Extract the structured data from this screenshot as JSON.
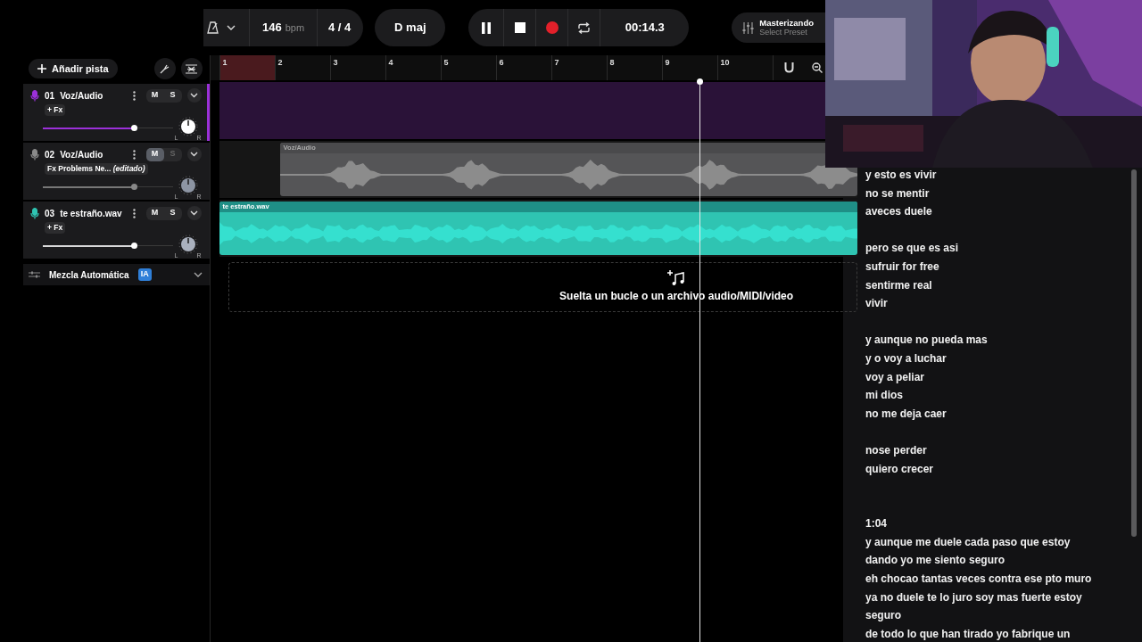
{
  "toolbar": {
    "bpm": "146",
    "bpm_unit": "bpm",
    "time_signature": "4 / 4",
    "key": "D maj",
    "playing": true,
    "time": "00:14.3",
    "mastering": {
      "title": "Masterizando",
      "preset": "Select Preset"
    }
  },
  "track_panel": {
    "add_button": "Añadir pista",
    "auto_mix": {
      "label": "Mezcla Automática",
      "badge": "IA"
    }
  },
  "tracks": [
    {
      "number": "01",
      "name": "Voz/Audio",
      "fx": "+ Fx",
      "selected": true,
      "muted": false,
      "color": "#9b30d9",
      "level": 0.7,
      "mute_label": "M",
      "solo_label": "S",
      "pan_left": "L",
      "pan_right": "R"
    },
    {
      "number": "02",
      "name": "Voz/Audio",
      "fx": "Fx Problems Ne... *(editado)*",
      "selected": false,
      "muted": true,
      "color": "#8a8a8a",
      "level": 0.7,
      "mute_label": "M",
      "solo_label": "S",
      "pan_left": "L",
      "pan_right": "R",
      "clip": {
        "name": "Voz/Audio"
      }
    },
    {
      "number": "03",
      "name": "te estraño.wav",
      "fx": "+ Fx",
      "selected": false,
      "muted": false,
      "color": "#2fc4b2",
      "level": 0.7,
      "mute_label": "M",
      "solo_label": "S",
      "pan_left": "L",
      "pan_right": "R",
      "clip": {
        "name": "te estraño.wav"
      }
    }
  ],
  "ruler": {
    "bars": [
      {
        "label": "1",
        "looped": true
      },
      {
        "label": "2",
        "looped": false
      },
      {
        "label": "3",
        "looped": false
      },
      {
        "label": "4",
        "looped": false
      },
      {
        "label": "5",
        "looped": false
      },
      {
        "label": "6",
        "looped": false
      },
      {
        "label": "7",
        "looped": false
      },
      {
        "label": "8",
        "looped": false
      },
      {
        "label": "9",
        "looped": false
      },
      {
        "label": "10",
        "looped": false
      }
    ]
  },
  "drop_zone": {
    "text": "Suelta un bucle o un archivo audio/MIDI/video"
  },
  "lyrics": {
    "stanzas": [
      {
        "kind": "verse",
        "lines": [
          "y esto es vivir",
          "no se mentir",
          "aveces duele"
        ]
      },
      {
        "kind": "verse",
        "lines": [
          "pero se que es asi",
          "sufruir for free",
          "sentirme real",
          "vivir"
        ]
      },
      {
        "kind": "verse",
        "lines": [
          "y aunque no pueda mas",
          "y o voy a luchar",
          "voy a peliar",
          "mi dios",
          "no me deja caer"
        ]
      },
      {
        "kind": "verse",
        "lines": [
          "nose perder",
          "quiero crecer"
        ]
      },
      {
        "kind": "timed",
        "time": "1:04",
        "lines": [
          "y aunque me duele cada paso que estoy dando yo me siento seguro",
          "eh chocao tantas veces contra ese pto muro",
          "ya no duele te lo juro soy mas fuerte estoy seguro",
          "de todo lo que han tirado yo fabrique un"
        ]
      }
    ]
  }
}
